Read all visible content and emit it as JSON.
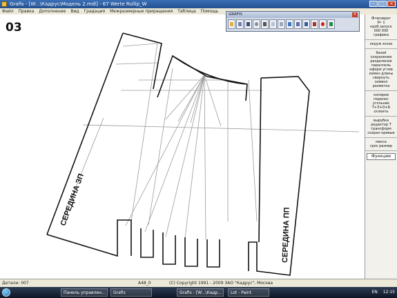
{
  "window": {
    "title": "Grafis - [W:..\\Кадрус\\Модель 2.mdl] - 67 Werte Rullip_W"
  },
  "menu": [
    "Файл",
    "Правка",
    "Дополнение",
    "Вид",
    "Градация",
    "Межразмерные приращения",
    "Таблица",
    "Помощь"
  ],
  "badge": "03",
  "pattern": {
    "back_label": "СЕРЕДИНА ЗП",
    "front_label": "СЕРЕДИНА ПП"
  },
  "toolbar_window": {
    "title": "GRAFIS",
    "tools": [
      "open-icon",
      "edit-icon",
      "save-icon",
      "zoom-icon",
      "print-icon",
      "grid-icon",
      "table-icon",
      "arrow-icon",
      "transform-icon",
      "layers-icon",
      "chart-icon",
      "stop-icon",
      "monitor-icon"
    ]
  },
  "panel": {
    "groups": [
      [
        "Ф•возврат",
        "Я•   1",
        "кроб.запуск",
        "000  000",
        "графика"
      ],
      [
        "окруж  эскиз"
      ],
      [
        "базой",
        "сохранение",
        "разделение",
        "параллель",
        "оформ  углов",
        "измен длины",
        "свернуть",
        "символ",
        "разметка"
      ],
      [
        "копиров",
        "перенос",
        "угольник",
        "Т+Э+О+Б",
        "склеить"
      ],
      [
        "вырубка",
        "редактор Т",
        "трансформ",
        "сохран кривые"
      ],
      [
        "мекса",
        "срос размер"
      ]
    ],
    "button": "Функции"
  },
  "statusbar": {
    "left": "Детали: 007",
    "mid": "A48_0",
    "copyright": "(C) Copyright 1991 - 2009 ЗАО \"Кадрус\", Москва"
  },
  "taskbar": {
    "tasks": [
      "Панель управлен...",
      "Grafis",
      "Grafis - [W:..\\Кадр...",
      "Lot - Paint"
    ],
    "lang": "EN",
    "time": "12:15"
  }
}
